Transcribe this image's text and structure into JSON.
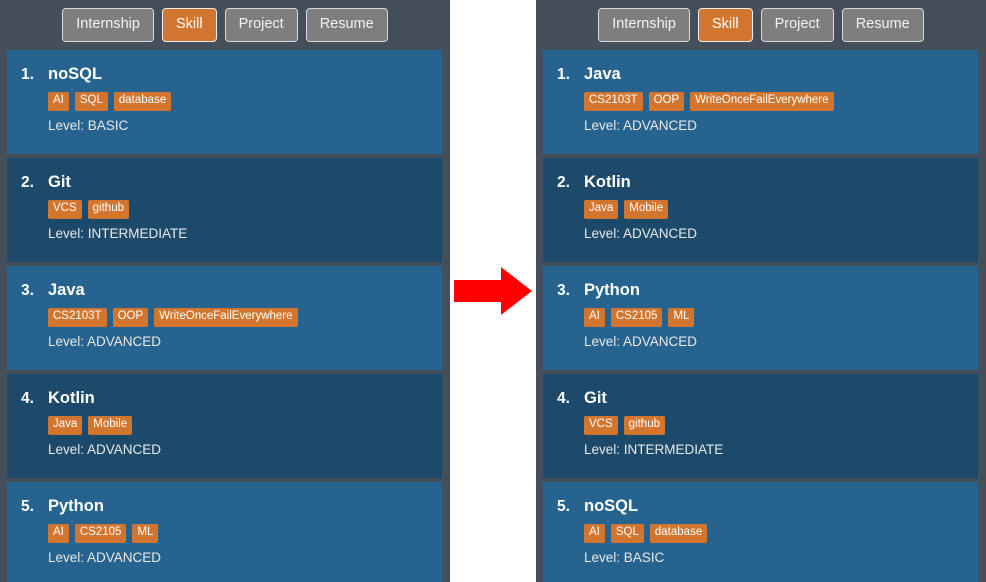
{
  "colors": {
    "app_background": "#454f59",
    "row_dark": "#1d4a6b",
    "row_light": "#26648f",
    "accent_orange": "#d2762f",
    "tab_inactive": "#7e7e7e",
    "arrow_red": "#fe0000",
    "gap_white": "#ffffff"
  },
  "tabs": [
    {
      "label": "Internship",
      "active": false
    },
    {
      "label": "Skill",
      "active": true
    },
    {
      "label": "Project",
      "active": false
    },
    {
      "label": "Resume",
      "active": false
    }
  ],
  "panels": {
    "before": {
      "name": "skill-list-before",
      "tabs": [
        {
          "label": "Internship",
          "active": false
        },
        {
          "label": "Skill",
          "active": true
        },
        {
          "label": "Project",
          "active": false
        },
        {
          "label": "Resume",
          "active": false
        }
      ],
      "items": [
        {
          "index": "1.",
          "name": "noSQL",
          "tags": [
            "AI",
            "SQL",
            "database"
          ],
          "level": "Level: BASIC"
        },
        {
          "index": "2.",
          "name": "Git",
          "tags": [
            "VCS",
            "github"
          ],
          "level": "Level: INTERMEDIATE"
        },
        {
          "index": "3.",
          "name": "Java",
          "tags": [
            "CS2103T",
            "OOP",
            "WriteOnceFailEverywhere"
          ],
          "level": "Level: ADVANCED"
        },
        {
          "index": "4.",
          "name": "Kotlin",
          "tags": [
            "Java",
            "Mobile"
          ],
          "level": "Level: ADVANCED"
        },
        {
          "index": "5.",
          "name": "Python",
          "tags": [
            "AI",
            "CS2105",
            "ML"
          ],
          "level": "Level: ADVANCED"
        }
      ]
    },
    "after": {
      "name": "skill-list-after",
      "tabs": [
        {
          "label": "Internship",
          "active": false
        },
        {
          "label": "Skill",
          "active": true
        },
        {
          "label": "Project",
          "active": false
        },
        {
          "label": "Resume",
          "active": false
        }
      ],
      "items": [
        {
          "index": "1.",
          "name": "Java",
          "tags": [
            "CS2103T",
            "OOP",
            "WriteOnceFailEverywhere"
          ],
          "level": "Level: ADVANCED"
        },
        {
          "index": "2.",
          "name": "Kotlin",
          "tags": [
            "Java",
            "Mobile"
          ],
          "level": "Level: ADVANCED"
        },
        {
          "index": "3.",
          "name": "Python",
          "tags": [
            "AI",
            "CS2105",
            "ML"
          ],
          "level": "Level: ADVANCED"
        },
        {
          "index": "4.",
          "name": "Git",
          "tags": [
            "VCS",
            "github"
          ],
          "level": "Level: INTERMEDIATE"
        },
        {
          "index": "5.",
          "name": "noSQL",
          "tags": [
            "AI",
            "SQL",
            "database"
          ],
          "level": "Level: BASIC"
        }
      ]
    }
  },
  "transition": {
    "icon": "right-arrow-icon"
  }
}
